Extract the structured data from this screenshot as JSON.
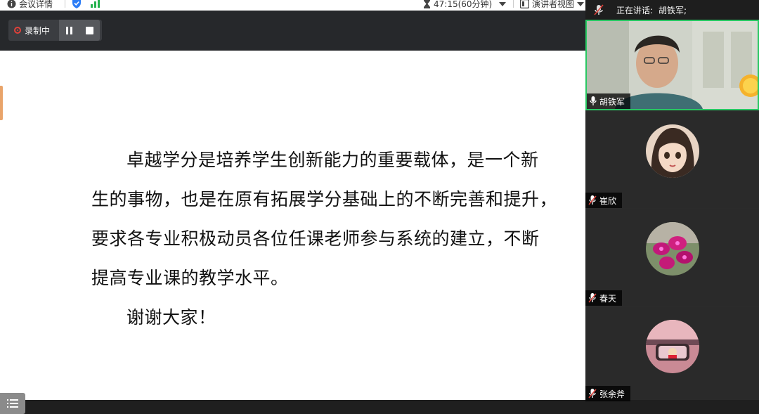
{
  "topbar": {
    "meeting_info": "会议详情",
    "timer": "47:15(60分钟)",
    "view_mode": "演讲者视图"
  },
  "recording": {
    "status_label": "录制中"
  },
  "slide": {
    "paragraph1_lines": [
      "卓越学分是培养学生创新能力的重要载体，是一个新",
      "生的事物，也是在原有拓展学分基础上的不断完善和提升，",
      "要求各专业积极动员各位任课老师参与系统的建立，不断",
      "提高专业课的教学水平。"
    ],
    "thanks": "谢谢大家！"
  },
  "sidebar": {
    "speaking_label": "正在讲话:",
    "speaking_name": "胡铁军;",
    "participants": [
      {
        "name": "胡铁军",
        "mic": "on",
        "video": true
      },
      {
        "name": "崔欣",
        "mic": "muted",
        "video": false
      },
      {
        "name": "春天",
        "mic": "muted",
        "video": false
      },
      {
        "name": "张余斧",
        "mic": "muted",
        "video": false
      }
    ]
  },
  "colors": {
    "active_speaker_border": "#29c763",
    "record_red": "#e0413a"
  }
}
